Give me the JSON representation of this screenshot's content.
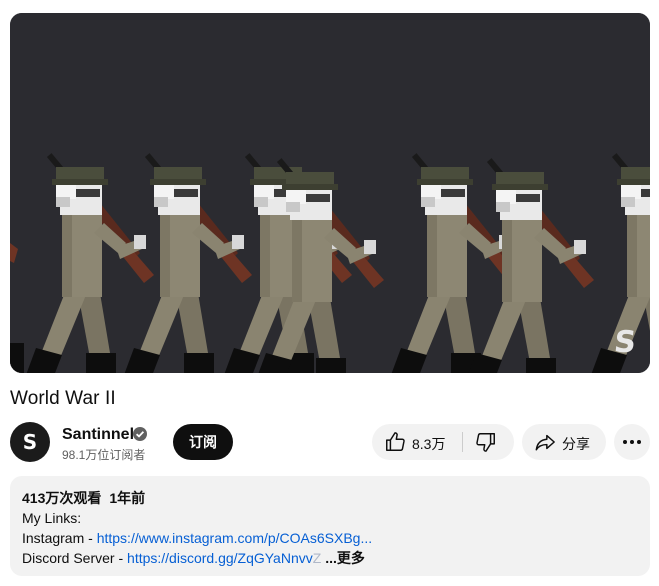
{
  "video": {
    "title": "World War II",
    "watermark": "S"
  },
  "channel": {
    "avatar_letter": "S",
    "name": "Santinnel",
    "subscribers": "98.1万位订阅者",
    "subscribe_label": "订阅"
  },
  "actions": {
    "like_count": "8.3万",
    "share_label": "分享"
  },
  "description": {
    "views": "413万次观看",
    "age": "1年前",
    "line1": "My Links:",
    "line2_prefix": "Instagram - ",
    "line2_link": "https://www.instagram.com/p/COAs6SXBg...",
    "line3_prefix": "Discord Server - ",
    "line3_link": "https://discord.gg/ZqGYaNnvv",
    "line3_link_faded": "Z",
    "more_label": "...更多"
  },
  "colors": {
    "link": "#065fd4",
    "video_background": "#2b2b30",
    "soldier_uniform": "#8a8470",
    "soldier_helmet": "#4a4d3c",
    "rifle": "#5a2a1e",
    "boots": "#0d0d0d"
  },
  "icons": {
    "like": "thumbs-up-icon",
    "dislike": "thumbs-down-icon",
    "share": "share-arrow-icon",
    "more": "more-horizontal-icon",
    "verified": "verified-check-icon"
  }
}
